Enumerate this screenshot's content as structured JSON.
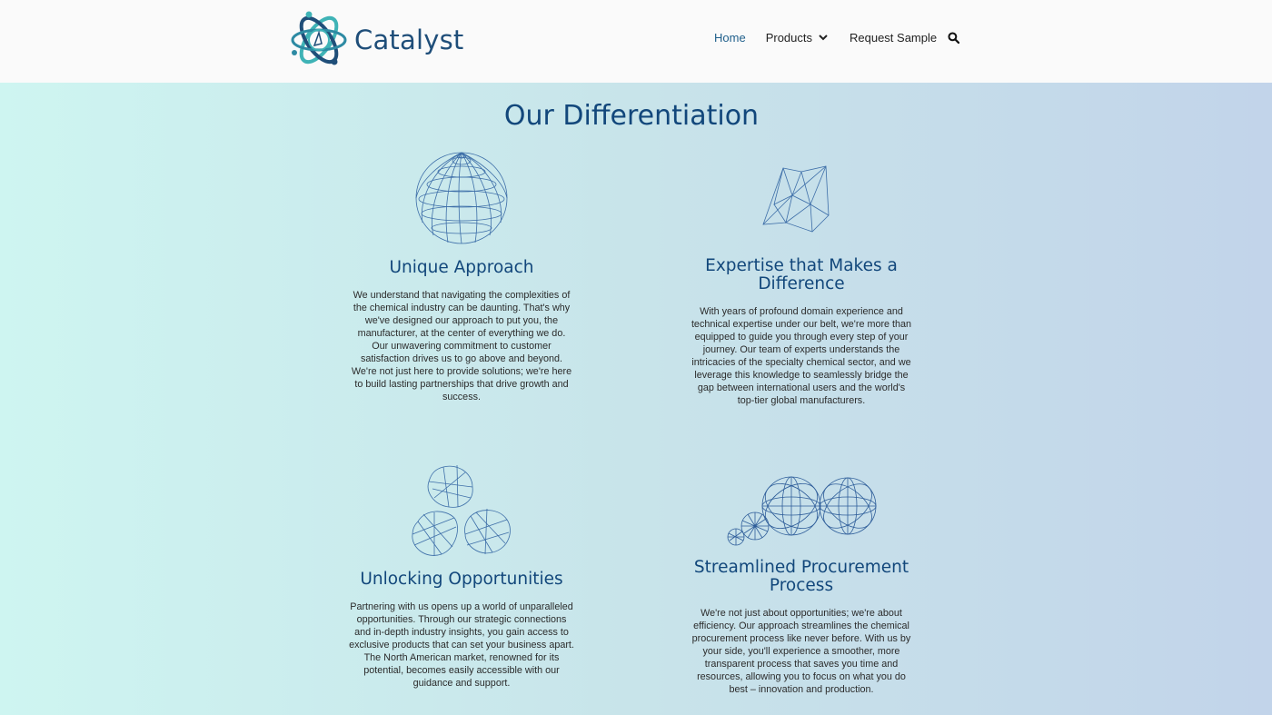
{
  "header": {
    "brand": "Catalyst",
    "nav": {
      "home": "Home",
      "products": "Products",
      "request_sample": "Request Sample"
    },
    "accent": "#1f4e79"
  },
  "main": {
    "title": "Our Differentiation",
    "cards": [
      {
        "title": "Unique Approach",
        "text": "We understand that navigating the complexities of the chemical industry can be daunting. That's why we've designed our approach to put you, the manufacturer, at the center of everything we do. Our unwavering commitment to customer satisfaction drives us to go above and beyond. We're not just here to provide solutions; we're here to build lasting partnerships that drive growth and success.",
        "icon": "wireframe-sphere-icon"
      },
      {
        "title": "Expertise that Makes a Difference",
        "text": "With years of profound domain experience and technical expertise under our belt, we're more than equipped to guide you through every step of your journey. Our team of experts understands the intricacies of the specialty chemical sector, and we leverage this knowledge to seamlessly bridge the gap between international users and the world's top-tier global manufacturers.",
        "icon": "polyhedron-icon"
      },
      {
        "title": "Unlocking Opportunities",
        "text": "Partnering with us opens up a world of unparalleled opportunities. Through our strategic connections and in-depth industry insights, you gain access to exclusive products that can set your business apart. The North American market, renowned for its potential, becomes easily accessible with our guidance and support.",
        "icon": "wireframe-rocks-icon"
      },
      {
        "title": "Streamlined Procurement Process",
        "text": "We're not just about opportunities; we're about efficiency. Our approach streamlines the chemical procurement process like never before. With us by your side, you'll experience a smoother, more transparent process that saves you time and resources, allowing you to focus on what you do best – innovation and production.",
        "icon": "wireframe-spheres-icon"
      }
    ]
  }
}
